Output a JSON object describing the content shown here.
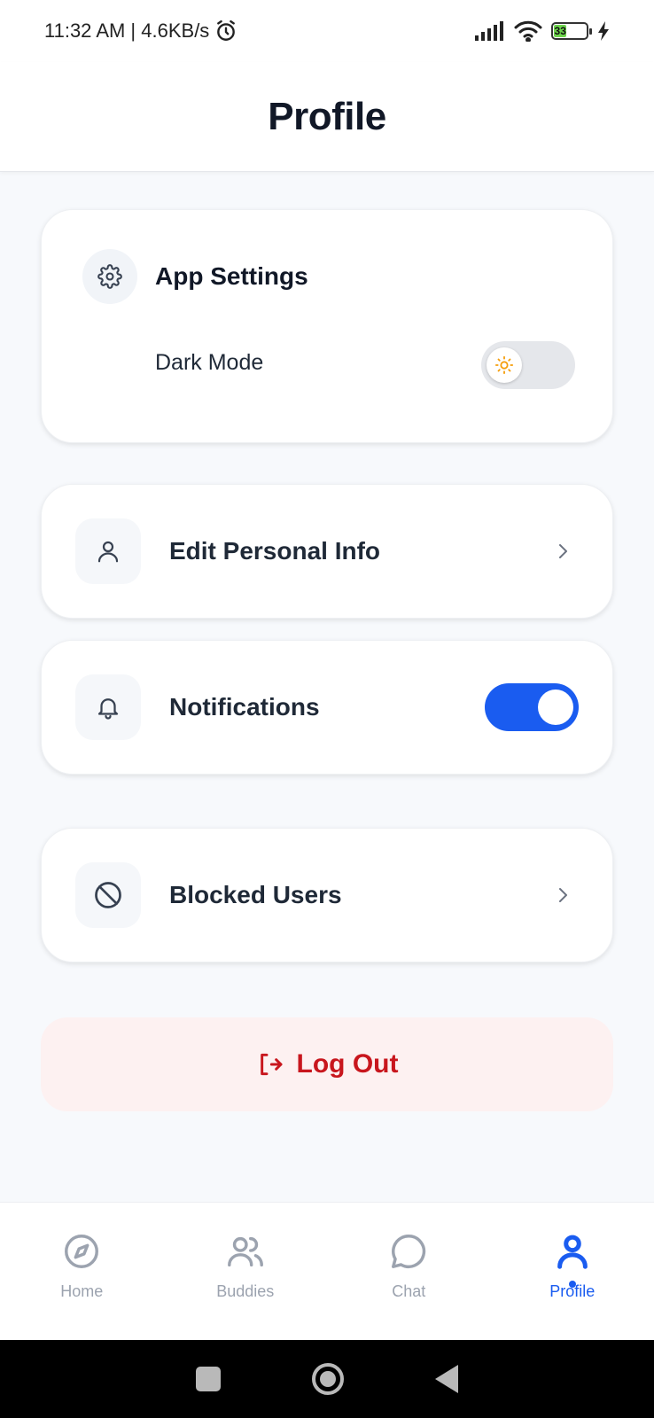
{
  "status_bar": {
    "time": "11:32 AM | 4.6KB/s",
    "battery_level": "33"
  },
  "header": {
    "title": "Profile"
  },
  "app_settings": {
    "title": "App Settings",
    "dark_mode_label": "Dark Mode",
    "dark_mode_on": false
  },
  "rows": {
    "edit_personal_info": "Edit Personal Info",
    "notifications": "Notifications",
    "notifications_on": true,
    "blocked_users": "Blocked Users"
  },
  "logout": {
    "label": "Log Out"
  },
  "bottom_nav": {
    "items": [
      {
        "label": "Home",
        "icon": "compass-icon",
        "active": false
      },
      {
        "label": "Buddies",
        "icon": "users-icon",
        "active": false
      },
      {
        "label": "Chat",
        "icon": "chat-bubble-icon",
        "active": false
      },
      {
        "label": "Profile",
        "icon": "user-icon",
        "active": true
      }
    ]
  },
  "colors": {
    "accent": "#1a5cf0",
    "danger": "#c8161d",
    "danger_bg": "#fdf1f1",
    "page_bg": "#f7f9fc"
  }
}
